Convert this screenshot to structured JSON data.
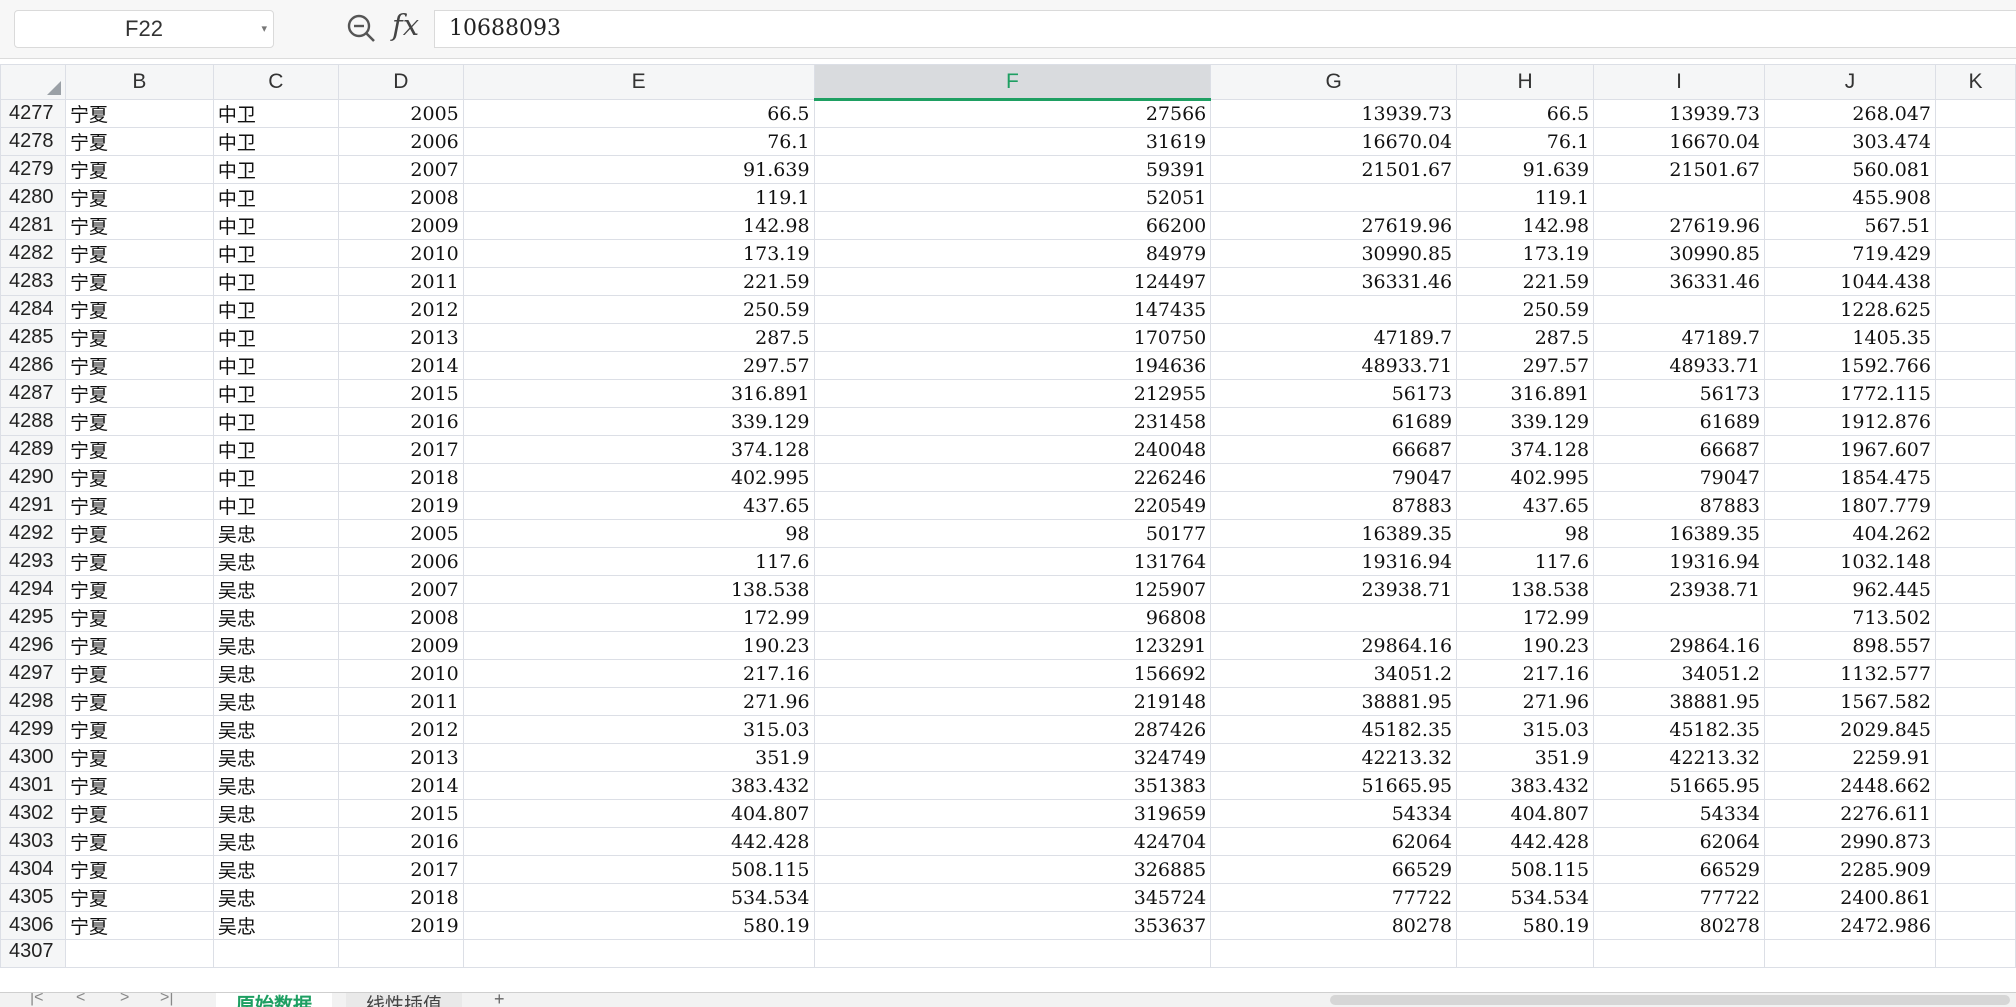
{
  "formula_bar": {
    "cell_ref": "F22",
    "fx_label": "fx",
    "value": "10688093"
  },
  "columns": [
    "B",
    "C",
    "D",
    "E",
    "F",
    "G",
    "H",
    "I",
    "J",
    "K"
  ],
  "selected_column": "F",
  "rows": [
    {
      "n": "4277",
      "b": "宁夏",
      "c": "中卫",
      "d": "2005",
      "e": "66.5",
      "f": "27566",
      "g": "13939.73",
      "h": "66.5",
      "i": "13939.73",
      "j": "268.047"
    },
    {
      "n": "4278",
      "b": "宁夏",
      "c": "中卫",
      "d": "2006",
      "e": "76.1",
      "f": "31619",
      "g": "16670.04",
      "h": "76.1",
      "i": "16670.04",
      "j": "303.474"
    },
    {
      "n": "4279",
      "b": "宁夏",
      "c": "中卫",
      "d": "2007",
      "e": "91.639",
      "f": "59391",
      "g": "21501.67",
      "h": "91.639",
      "i": "21501.67",
      "j": "560.081"
    },
    {
      "n": "4280",
      "b": "宁夏",
      "c": "中卫",
      "d": "2008",
      "e": "119.1",
      "f": "52051",
      "g": "",
      "h": "119.1",
      "i": "",
      "j": "455.908"
    },
    {
      "n": "4281",
      "b": "宁夏",
      "c": "中卫",
      "d": "2009",
      "e": "142.98",
      "f": "66200",
      "g": "27619.96",
      "h": "142.98",
      "i": "27619.96",
      "j": "567.51"
    },
    {
      "n": "4282",
      "b": "宁夏",
      "c": "中卫",
      "d": "2010",
      "e": "173.19",
      "f": "84979",
      "g": "30990.85",
      "h": "173.19",
      "i": "30990.85",
      "j": "719.429"
    },
    {
      "n": "4283",
      "b": "宁夏",
      "c": "中卫",
      "d": "2011",
      "e": "221.59",
      "f": "124497",
      "g": "36331.46",
      "h": "221.59",
      "i": "36331.46",
      "j": "1044.438"
    },
    {
      "n": "4284",
      "b": "宁夏",
      "c": "中卫",
      "d": "2012",
      "e": "250.59",
      "f": "147435",
      "g": "",
      "h": "250.59",
      "i": "",
      "j": "1228.625"
    },
    {
      "n": "4285",
      "b": "宁夏",
      "c": "中卫",
      "d": "2013",
      "e": "287.5",
      "f": "170750",
      "g": "47189.7",
      "h": "287.5",
      "i": "47189.7",
      "j": "1405.35"
    },
    {
      "n": "4286",
      "b": "宁夏",
      "c": "中卫",
      "d": "2014",
      "e": "297.57",
      "f": "194636",
      "g": "48933.71",
      "h": "297.57",
      "i": "48933.71",
      "j": "1592.766"
    },
    {
      "n": "4287",
      "b": "宁夏",
      "c": "中卫",
      "d": "2015",
      "e": "316.891",
      "f": "212955",
      "g": "56173",
      "h": "316.891",
      "i": "56173",
      "j": "1772.115"
    },
    {
      "n": "4288",
      "b": "宁夏",
      "c": "中卫",
      "d": "2016",
      "e": "339.129",
      "f": "231458",
      "g": "61689",
      "h": "339.129",
      "i": "61689",
      "j": "1912.876"
    },
    {
      "n": "4289",
      "b": "宁夏",
      "c": "中卫",
      "d": "2017",
      "e": "374.128",
      "f": "240048",
      "g": "66687",
      "h": "374.128",
      "i": "66687",
      "j": "1967.607"
    },
    {
      "n": "4290",
      "b": "宁夏",
      "c": "中卫",
      "d": "2018",
      "e": "402.995",
      "f": "226246",
      "g": "79047",
      "h": "402.995",
      "i": "79047",
      "j": "1854.475"
    },
    {
      "n": "4291",
      "b": "宁夏",
      "c": "中卫",
      "d": "2019",
      "e": "437.65",
      "f": "220549",
      "g": "87883",
      "h": "437.65",
      "i": "87883",
      "j": "1807.779"
    },
    {
      "n": "4292",
      "b": "宁夏",
      "c": "吴忠",
      "d": "2005",
      "e": "98",
      "f": "50177",
      "g": "16389.35",
      "h": "98",
      "i": "16389.35",
      "j": "404.262"
    },
    {
      "n": "4293",
      "b": "宁夏",
      "c": "吴忠",
      "d": "2006",
      "e": "117.6",
      "f": "131764",
      "g": "19316.94",
      "h": "117.6",
      "i": "19316.94",
      "j": "1032.148"
    },
    {
      "n": "4294",
      "b": "宁夏",
      "c": "吴忠",
      "d": "2007",
      "e": "138.538",
      "f": "125907",
      "g": "23938.71",
      "h": "138.538",
      "i": "23938.71",
      "j": "962.445"
    },
    {
      "n": "4295",
      "b": "宁夏",
      "c": "吴忠",
      "d": "2008",
      "e": "172.99",
      "f": "96808",
      "g": "",
      "h": "172.99",
      "i": "",
      "j": "713.502"
    },
    {
      "n": "4296",
      "b": "宁夏",
      "c": "吴忠",
      "d": "2009",
      "e": "190.23",
      "f": "123291",
      "g": "29864.16",
      "h": "190.23",
      "i": "29864.16",
      "j": "898.557"
    },
    {
      "n": "4297",
      "b": "宁夏",
      "c": "吴忠",
      "d": "2010",
      "e": "217.16",
      "f": "156692",
      "g": "34051.2",
      "h": "217.16",
      "i": "34051.2",
      "j": "1132.577"
    },
    {
      "n": "4298",
      "b": "宁夏",
      "c": "吴忠",
      "d": "2011",
      "e": "271.96",
      "f": "219148",
      "g": "38881.95",
      "h": "271.96",
      "i": "38881.95",
      "j": "1567.582"
    },
    {
      "n": "4299",
      "b": "宁夏",
      "c": "吴忠",
      "d": "2012",
      "e": "315.03",
      "f": "287426",
      "g": "45182.35",
      "h": "315.03",
      "i": "45182.35",
      "j": "2029.845"
    },
    {
      "n": "4300",
      "b": "宁夏",
      "c": "吴忠",
      "d": "2013",
      "e": "351.9",
      "f": "324749",
      "g": "42213.32",
      "h": "351.9",
      "i": "42213.32",
      "j": "2259.91"
    },
    {
      "n": "4301",
      "b": "宁夏",
      "c": "吴忠",
      "d": "2014",
      "e": "383.432",
      "f": "351383",
      "g": "51665.95",
      "h": "383.432",
      "i": "51665.95",
      "j": "2448.662"
    },
    {
      "n": "4302",
      "b": "宁夏",
      "c": "吴忠",
      "d": "2015",
      "e": "404.807",
      "f": "319659",
      "g": "54334",
      "h": "404.807",
      "i": "54334",
      "j": "2276.611"
    },
    {
      "n": "4303",
      "b": "宁夏",
      "c": "吴忠",
      "d": "2016",
      "e": "442.428",
      "f": "424704",
      "g": "62064",
      "h": "442.428",
      "i": "62064",
      "j": "2990.873"
    },
    {
      "n": "4304",
      "b": "宁夏",
      "c": "吴忠",
      "d": "2017",
      "e": "508.115",
      "f": "326885",
      "g": "66529",
      "h": "508.115",
      "i": "66529",
      "j": "2285.909"
    },
    {
      "n": "4305",
      "b": "宁夏",
      "c": "吴忠",
      "d": "2018",
      "e": "534.534",
      "f": "345724",
      "g": "77722",
      "h": "534.534",
      "i": "77722",
      "j": "2400.861"
    },
    {
      "n": "4306",
      "b": "宁夏",
      "c": "吴忠",
      "d": "2019",
      "e": "580.19",
      "f": "353637",
      "g": "80278",
      "h": "580.19",
      "i": "80278",
      "j": "2472.986"
    }
  ],
  "partial_row": "4307",
  "sheet_tabs": [
    {
      "label": "原始数据",
      "active": true
    },
    {
      "label": "线性插值",
      "active": false
    }
  ],
  "icons": {
    "zoom": "zoom-out-icon",
    "dropdown": "chevron-down-icon",
    "add_sheet": "plus-icon"
  },
  "colors": {
    "accent": "#1e9f62",
    "selected_header_bg": "#d9dbde"
  }
}
